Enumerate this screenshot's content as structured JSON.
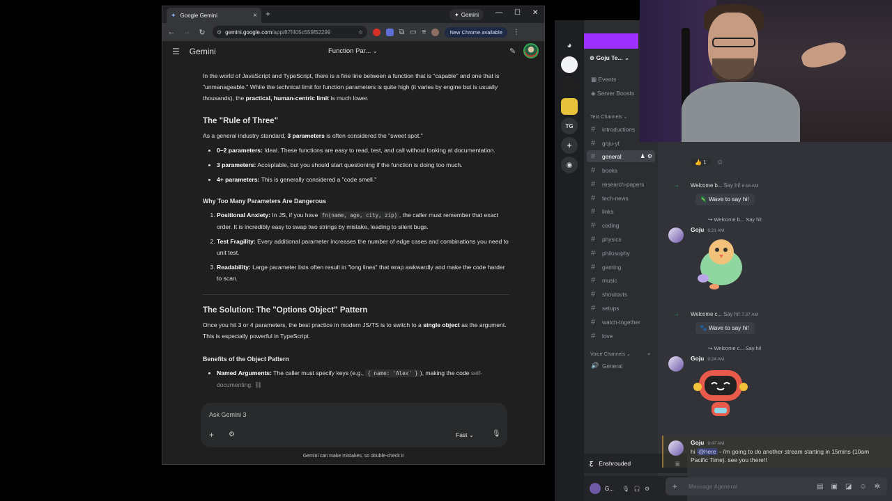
{
  "chrome": {
    "tab_title": "Google Gemini",
    "tab_close": "×",
    "new_tab": "+",
    "profile_chip": "Gemini",
    "url_host": "gemini.google.com",
    "url_path": "/app/87f405c559f52299",
    "new_chrome_label": "New Chrome available",
    "nav_back": "←",
    "nav_forward": "→",
    "nav_reload": "↻",
    "win_min": "—",
    "win_max": "☐",
    "win_close": "✕"
  },
  "gemini": {
    "app_title": "Gemini",
    "chat_title": "Function Par...",
    "intro": {
      "t1": "In the world of JavaScript and TypeScript, there is a fine line between a function that is \"capable\" and one that is \"unmanageable.\" While the technical limit for function parameters is quite high (it varies by engine but is usually thousands), the ",
      "b1": "practical, human-centric limit",
      "t2": " is much lower."
    },
    "rule_heading": "The \"Rule of Three\"",
    "rule_intro": {
      "t1": "As a general industry standard, ",
      "b1": "3 parameters",
      "t2": " is often considered the \"sweet spot.\""
    },
    "rule_items": [
      {
        "b": "0–2 parameters:",
        "t": " Ideal. These functions are easy to read, test, and call without looking at documentation."
      },
      {
        "b": "3 parameters:",
        "t": " Acceptable, but you should start questioning if the function is doing too much."
      },
      {
        "b": "4+ parameters:",
        "t": " This is generally considered a \"code smell.\""
      }
    ],
    "why_heading": "Why Too Many Parameters Are Dangerous",
    "why_items": [
      {
        "b": "Positional Anxiety:",
        "t1": " In JS, if you have ",
        "code": "fn(name, age, city, zip)",
        "t2": ", the caller must remember that exact order. It is incredibly easy to swap two strings by mistake, leading to silent bugs."
      },
      {
        "b": "Test Fragility:",
        "t1": " Every additional parameter increases the number of edge cases and combinations you need to unit test.",
        "code": "",
        "t2": ""
      },
      {
        "b": "Readability:",
        "t1": " Large parameter lists often result in \"long lines\" that wrap awkwardly and make the code harder to scan.",
        "code": "",
        "t2": ""
      }
    ],
    "solution_heading": "The Solution: The \"Options Object\" Pattern",
    "solution_intro": {
      "t1": "Once you hit 3 or 4 parameters, the best practice in modern JS/TS is to switch to a ",
      "b1": "single object",
      "t2": " as the argument. This is especially powerful in TypeScript."
    },
    "benefits_heading": "Benefits of the Object Pattern",
    "benefit_item": {
      "b": "Named Arguments:",
      "t1": " The caller must specify keys (e.g., ",
      "code": "{ name: 'Alex' }",
      "t2": "), making the code ",
      "fade": "self-documenting."
    },
    "input_placeholder": "Ask Gemini 3",
    "mode_label": "Fast",
    "disclaimer": "Gemini can make mistakes, so double-check it"
  },
  "discord": {
    "server_name": "Goju Te...",
    "events": "Events",
    "server_boosts": "Server Boosts",
    "text_channels_label": "Text Channels",
    "channels": [
      "introductions",
      "goju-yt",
      "general",
      "books",
      "research-papers",
      "tech-news",
      "links",
      "coding",
      "physics",
      "philosophy",
      "gaming",
      "music",
      "shoutouts",
      "setups",
      "watch-together",
      "love"
    ],
    "active_channel": "general",
    "voice_channels_label": "Voice Channels",
    "voice_channels": [
      "General"
    ],
    "now_playing": "Enshrouded",
    "user_short": "G...",
    "guild_tg": "TG",
    "reaction_count": "1",
    "messages": {
      "sys1_user": "Welcome b...",
      "sys1_rest": " Say hi!",
      "sys1_time": "6:16 AM",
      "wave": "Wave to say hi!",
      "reply1": "↪ Welcome b... Say hi!",
      "author": "Goju",
      "time1": "6:21 AM",
      "sys2_user": "Welcome c...",
      "sys2_rest": " Say hi!",
      "sys2_time": "7:37 AM",
      "reply2": "↪ Welcome c... Say hi!",
      "time2": "9:24 AM",
      "time3": "9:47 AM",
      "last_t1": "hi ",
      "last_mention": "@here",
      "last_t2": " - i'm going to do another stream starting in 15mins (10am Pacific Time). see you there!!"
    },
    "compose_placeholder": "Message #general"
  }
}
